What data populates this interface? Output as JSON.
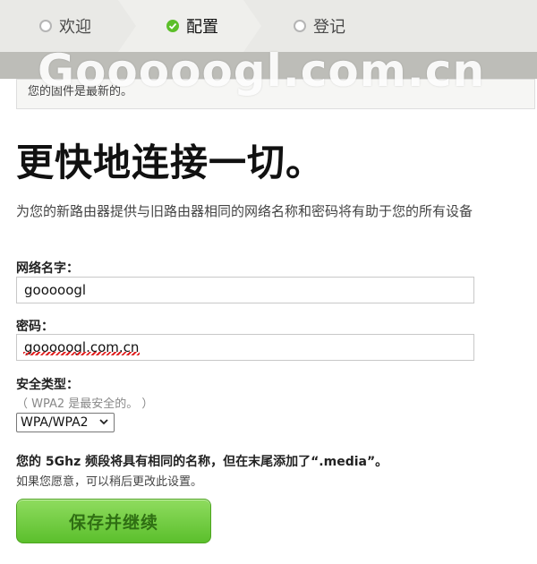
{
  "steps": [
    {
      "label": "欢迎",
      "state": "inactive"
    },
    {
      "label": "配置",
      "state": "active"
    },
    {
      "label": "登记",
      "state": "inactive"
    }
  ],
  "watermark": "Gooooogl.com.cn",
  "notice": "您的固件是最新的。",
  "headline": "更快地连接一切。",
  "subtitle": "为您的新路由器提供与旧路由器相同的网络名称和密码将有助于您的所有设备",
  "form": {
    "network_name_label": "网络名字：",
    "network_name_value": "gooooogl",
    "password_label": "密码：",
    "password_value": "gooooogl.com.cn",
    "security_type_label": "安全类型：",
    "security_hint": "（ WPA2 是最安全的。 ）",
    "security_selected": "WPA/WPA2"
  },
  "note_5ghz": "您的 5Ghz 频段将具有相同的名称，但在末尾添加了“.media”。",
  "note_later": "如果您愿意，可以稍后更改此设置。",
  "submit_label": "保存并继续",
  "colors": {
    "accent_green": "#5cbf2a"
  }
}
